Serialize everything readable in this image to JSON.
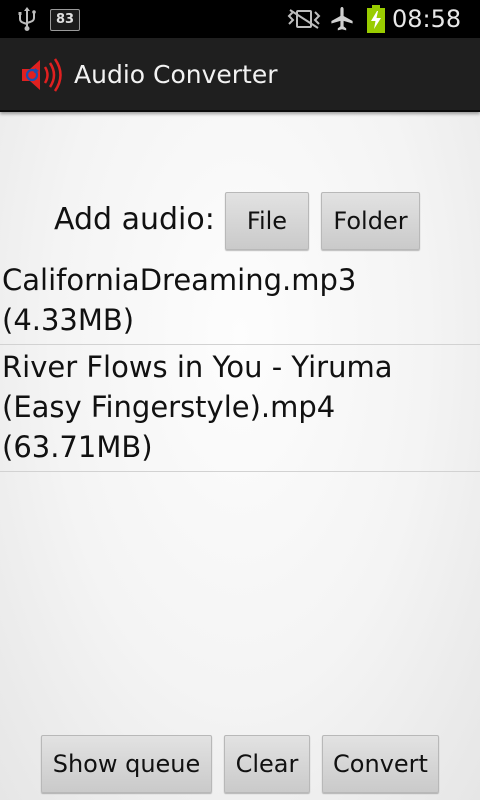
{
  "status_bar": {
    "notification_count": "83",
    "time": "08:58",
    "icons": [
      "usb-icon",
      "vibrate-icon",
      "airplane-mode-icon",
      "battery-charging-icon"
    ]
  },
  "action_bar": {
    "app_icon": "speaker-convert-icon",
    "title": "Audio Converter"
  },
  "add_audio": {
    "label": "Add audio:",
    "file_button": "File",
    "folder_button": "Folder"
  },
  "files": [
    {
      "name": "CaliforniaDreaming.mp3",
      "size": "(4.33MB)"
    },
    {
      "name_line1": "River Flows in You - Yiruma",
      "name_line2": "(Easy Fingerstyle).mp4",
      "size": "(63.71MB)"
    }
  ],
  "bottom_bar": {
    "show_queue": "Show queue",
    "clear": "Clear",
    "convert": "Convert"
  },
  "colors": {
    "status_bar_bg": "#000000",
    "action_bar_bg": "#1f1f1f",
    "battery_fill": "#99cc00",
    "speaker_red": "#e02020"
  }
}
